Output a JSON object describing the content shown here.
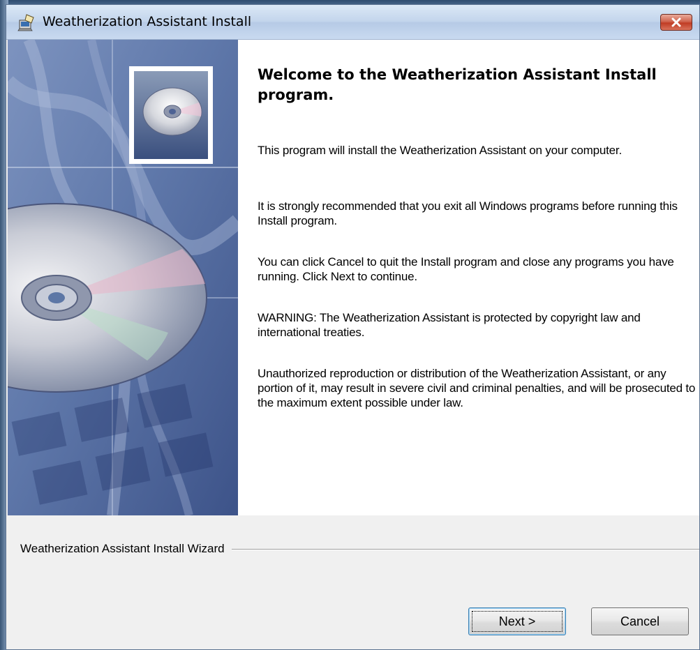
{
  "window": {
    "title": "Weatherization Assistant Install",
    "close_glyph": "✕"
  },
  "content": {
    "heading": "Welcome to the Weatherization Assistant Install program.",
    "paragraphs": [
      "This program will install the Weatherization Assistant on your computer.",
      "It is strongly recommended that you exit all Windows programs before running this Install program.",
      "You can click Cancel to quit the Install program and close any programs you have running.  Click Next to continue.",
      "WARNING: The Weatherization Assistant is protected by copyright law and international treaties.",
      "Unauthorized reproduction or distribution of the Weatherization Assistant, or any portion of it, may result in severe civil and criminal penalties, and will be prosecuted to the maximum extent possible under law."
    ]
  },
  "footer": {
    "wizard_label": "Weatherization Assistant Install Wizard",
    "next_label": "Next >",
    "cancel_label": "Cancel"
  },
  "icons": {
    "title": "installer-app-icon",
    "art": "cd-disc-icon"
  },
  "colors": {
    "art_blue": "#5d77a6",
    "titlebar": "#c3d5ec",
    "close_red": "#c03c24"
  }
}
